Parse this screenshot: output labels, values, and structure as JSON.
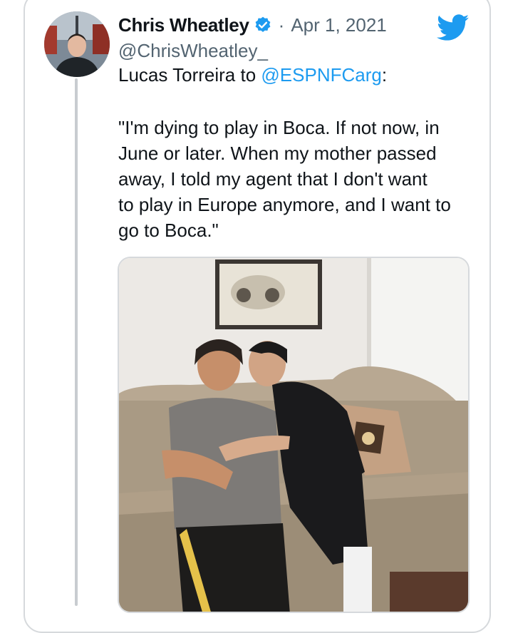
{
  "tweet": {
    "author_name": "Chris Wheatley",
    "separator": "·",
    "date": "Apr 1, 2021",
    "handle": "@ChrisWheatley_",
    "intro_text": "Lucas Torreira to ",
    "mention": "@ESPNFCarg",
    "intro_suffix": ":",
    "quote": "\"I'm dying to play in Boca. If not now, in\nJune or later. When my mother passed\naway, I told my agent that I don't want\nto play in Europe anymore, and I want to\ngo to Boca.\""
  },
  "icons": {
    "verified": "verified-badge-icon",
    "platform": "twitter-bird-icon"
  },
  "colors": {
    "link": "#1d9bf0",
    "text": "#0f1419",
    "muted": "#536471",
    "border": "#d6d9dc"
  }
}
